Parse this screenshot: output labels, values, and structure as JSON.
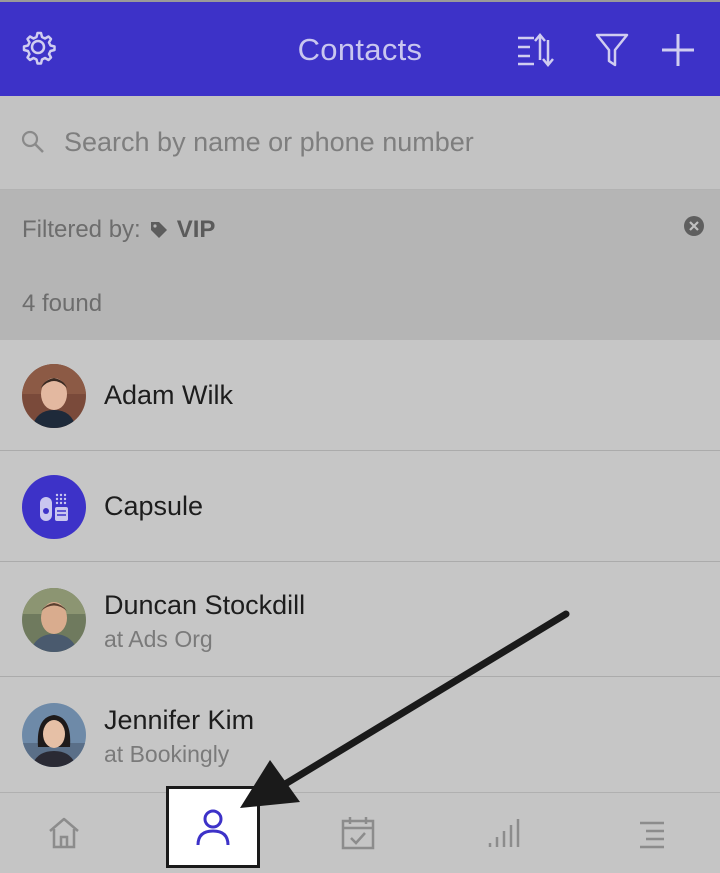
{
  "header": {
    "title": "Contacts",
    "icons": [
      "gear-icon",
      "sort-icon",
      "filter-icon",
      "plus-icon"
    ]
  },
  "search": {
    "placeholder": "Search by name or phone number"
  },
  "filter": {
    "label": "Filtered by:",
    "tag": "VIP",
    "count_text": "4 found"
  },
  "contacts": [
    {
      "name": "Adam Wilk",
      "org": ""
    },
    {
      "name": "Capsule",
      "org": ""
    },
    {
      "name": "Duncan Stockdill",
      "org": "at Ads Org"
    },
    {
      "name": "Jennifer Kim",
      "org": "at Bookingly"
    }
  ],
  "tabs": [
    "home-icon",
    "person-icon",
    "calendar-check-icon",
    "bar-chart-icon",
    "menu-icon"
  ],
  "colors": {
    "accent": "#3d32c8",
    "overlay_gray": "#c5c5c5"
  }
}
